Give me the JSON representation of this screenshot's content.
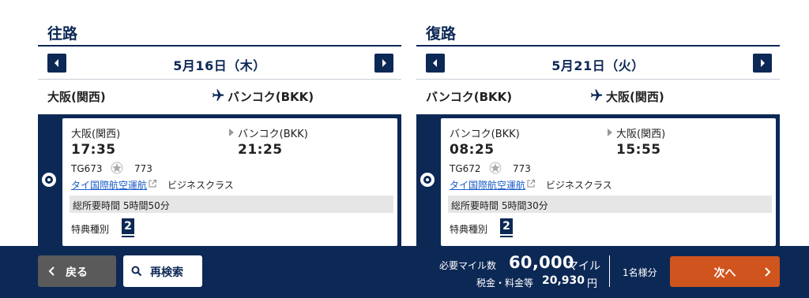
{
  "outbound": {
    "title": "往路",
    "date": "5月16日（木）",
    "route_from": "大阪(関西)",
    "route_to": "バンコク(BKK)",
    "flight": {
      "dep_city": "大阪(関西)",
      "dep_time": "17:35",
      "arr_city": "バンコク(BKK)",
      "arr_time": "21:25",
      "flight_no": "TG673",
      "aircraft": "773",
      "carrier": "タイ国際航空運航",
      "cabin": "ビジネスクラス",
      "duration": "総所要時間 5時間50分",
      "award_label": "特典種別",
      "award_type": "2"
    }
  },
  "return": {
    "title": "復路",
    "date": "5月21日（火）",
    "route_from": "バンコク(BKK)",
    "route_to": "大阪(関西)",
    "flight": {
      "dep_city": "バンコク(BKK)",
      "dep_time": "08:25",
      "arr_city": "大阪(関西)",
      "arr_time": "15:55",
      "flight_no": "TG672",
      "aircraft": "773",
      "carrier": "タイ国際航空運航",
      "cabin": "ビジネスクラス",
      "duration": "総所要時間 5時間30分",
      "award_label": "特典種別",
      "award_type": "2"
    }
  },
  "footer": {
    "back_label": "戻る",
    "research_label": "再検索",
    "miles_label": "必要マイル数",
    "miles_value": "60,000",
    "miles_unit": "マイル",
    "tax_label": "税金・料金等",
    "tax_value": "20,930",
    "tax_unit": "円",
    "pax": "1名様分",
    "next_label": "次へ"
  },
  "colors": {
    "navy": "#0c2855",
    "next_button": "#d0541e",
    "back_button": "#5a5a5a",
    "link": "#1a5dc9"
  },
  "icons": [
    "chevron-left-icon",
    "chevron-right-icon",
    "airplane-icon",
    "star-alliance-icon",
    "external-link-icon",
    "search-icon"
  ]
}
